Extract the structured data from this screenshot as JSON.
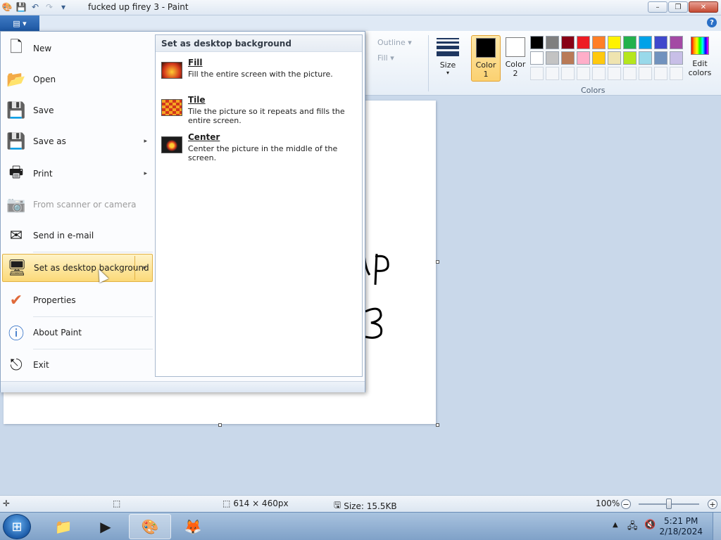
{
  "window": {
    "title": "fucked up firey 3 - Paint",
    "controls": {
      "minimize": "–",
      "maximize": "❐",
      "close": "✕"
    }
  },
  "ribbon": {
    "file_button_label": "▤ ▾",
    "help_label": "?",
    "outline_label": "Outline ▾",
    "fill_label": "Fill ▾",
    "size_label": "Size",
    "size_arrow": "▾",
    "color1_label_line1": "Color",
    "color1_label_line2": "1",
    "color2_label_line1": "Color",
    "color2_label_line2": "2",
    "edit_colors_line1": "Edit",
    "edit_colors_line2": "colors",
    "colors_group_label": "Colors",
    "color1_value": "#000000",
    "color2_value": "#ffffff",
    "palette": [
      "#000000",
      "#7f7f7f",
      "#880015",
      "#ed1c24",
      "#ff7f27",
      "#fff200",
      "#22b14c",
      "#00a2e8",
      "#3f48cc",
      "#a349a4",
      "#ffffff",
      "#c3c3c3",
      "#b97a57",
      "#ffaec9",
      "#ffc90e",
      "#efe4b0",
      "#b5e61d",
      "#99d9ea",
      "#7092be",
      "#c8bfe7",
      "#f4f6f9",
      "#f4f6f9",
      "#f4f6f9",
      "#f4f6f9",
      "#f4f6f9",
      "#f4f6f9",
      "#f4f6f9",
      "#f4f6f9",
      "#f4f6f9",
      "#f4f6f9"
    ]
  },
  "file_menu": {
    "items": [
      {
        "label": "New",
        "icon": "new-document-icon",
        "glyph": "🗋"
      },
      {
        "label": "Open",
        "icon": "open-folder-icon",
        "glyph": "📂"
      },
      {
        "label": "Save",
        "icon": "save-disk-icon",
        "glyph": "💾"
      },
      {
        "label": "Save as",
        "icon": "save-as-icon",
        "glyph": "💾",
        "arrow": "▸"
      },
      {
        "label": "Print",
        "icon": "printer-icon",
        "glyph": "🖶",
        "arrow": "▸"
      },
      {
        "label": "From scanner or camera",
        "icon": "scanner-icon",
        "glyph": "📷",
        "disabled": true
      },
      {
        "label": "Send in e-mail",
        "icon": "email-icon",
        "glyph": "✉"
      },
      {
        "label": "Set as desktop background",
        "icon": "desktop-background-icon",
        "glyph": "🖥",
        "arrow": "▸",
        "hover": true
      },
      {
        "label": "Properties",
        "icon": "checkmark-icon",
        "glyph": "✔"
      },
      {
        "label": "About Paint",
        "icon": "info-icon",
        "glyph": "ⓘ"
      },
      {
        "label": "Exit",
        "icon": "exit-icon",
        "glyph": "⎋"
      }
    ]
  },
  "submenu": {
    "header": "Set as desktop background",
    "options": [
      {
        "title": "Fill",
        "description": "Fill the entire screen with the picture."
      },
      {
        "title": "Tile",
        "description": "Tile the picture so it repeats and fills the entire screen."
      },
      {
        "title": "Center",
        "description": "Center the picture in the middle of the screen."
      }
    ]
  },
  "canvas": {
    "drawn_text_line1": "UP",
    "drawn_text_line2": "3"
  },
  "statusbar": {
    "dimensions": "614 × 460px",
    "size": "Size: 15.5KB",
    "zoom": "100%",
    "zoom_out": "−",
    "zoom_in": "+"
  },
  "taskbar": {
    "time": "5:21 PM",
    "date": "2/18/2024"
  }
}
